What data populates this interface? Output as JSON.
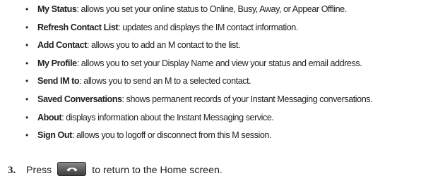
{
  "bullets": [
    {
      "term": "My Status",
      "desc": ": allows you set your online status to Online, Busy, Away, or Appear Offline."
    },
    {
      "term": "Refresh Contact List",
      "desc": ": updates and displays the IM contact information."
    },
    {
      "term": "Add Contact",
      "desc": ": allows you to add an  M contact to the list."
    },
    {
      "term": "My Profile",
      "desc": ": allows you to set your Display Name and view your status and email address."
    },
    {
      "term": "Send IM to",
      "desc": ": allows you to send an  M to a selected contact."
    },
    {
      "term": "Saved Conversations",
      "desc": ": shows permanent records of your Instant Messaging conversations."
    },
    {
      "term": "About",
      "desc": ": displays information about the Instant Messaging service."
    },
    {
      "term": "Sign Out",
      "desc": ": allows you to logoff or disconnect from this  M session."
    }
  ],
  "bullet_glyph": "•",
  "step": {
    "number": "3.",
    "before": "Press",
    "key_icon": "end-call-key-icon",
    "after": "to return to the Home screen."
  }
}
